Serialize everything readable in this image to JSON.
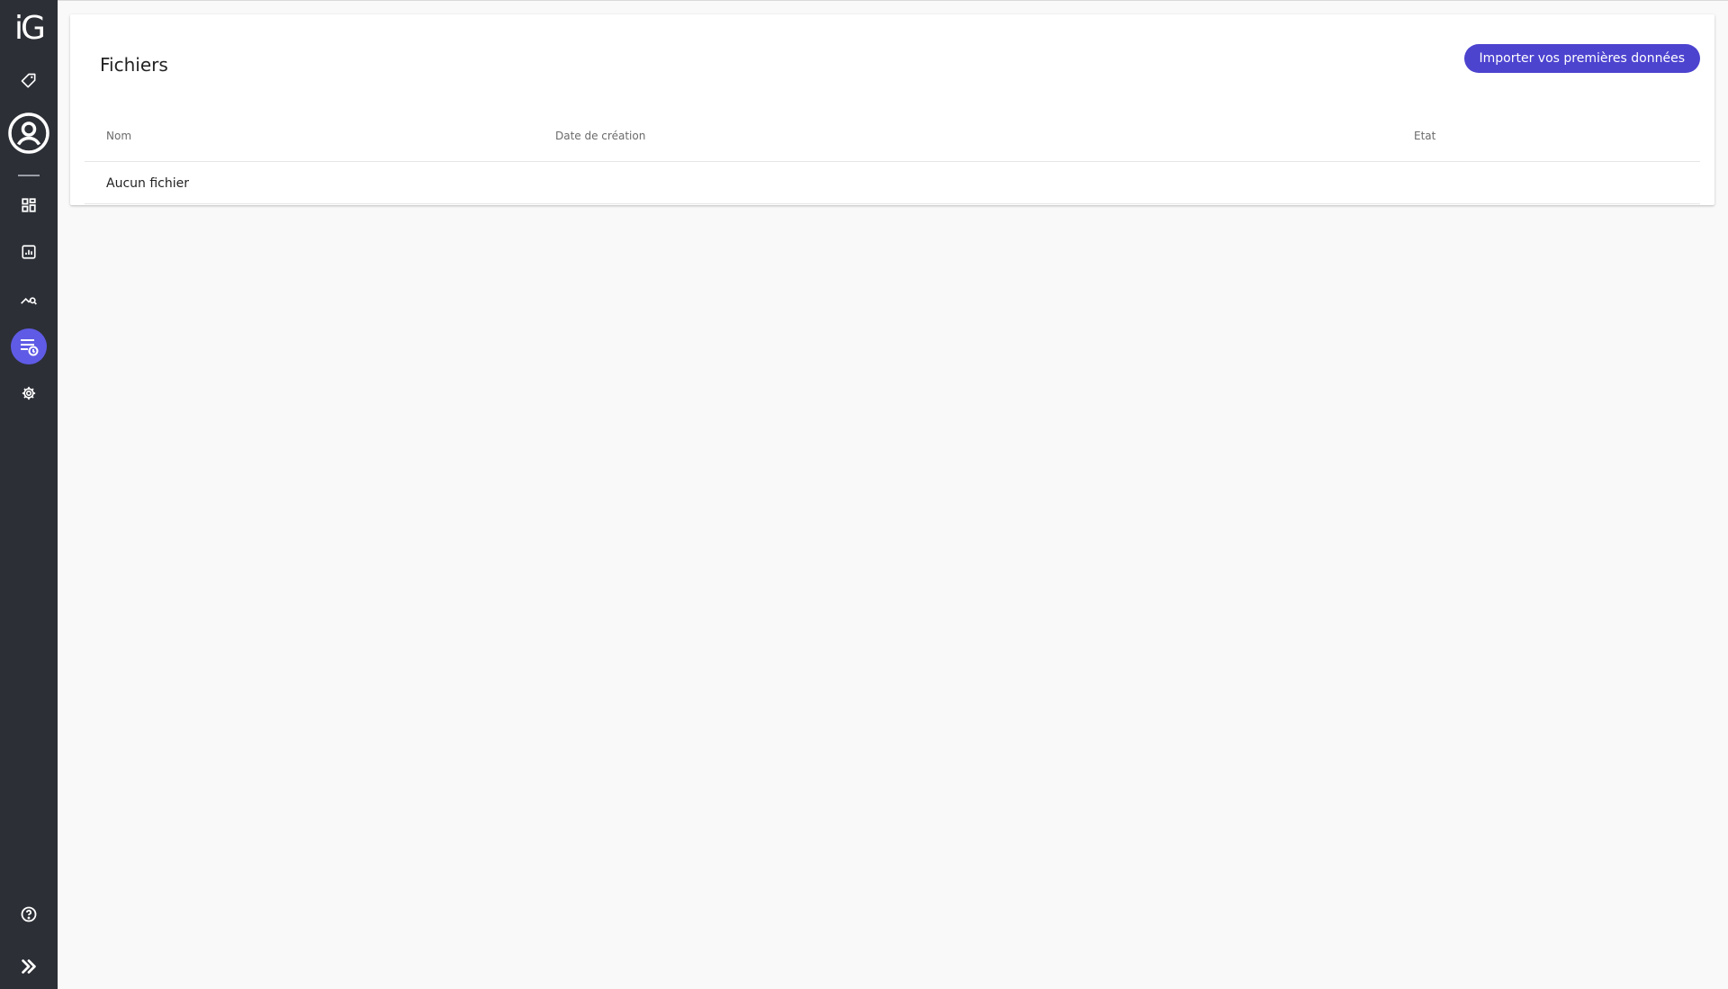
{
  "app": {
    "logo_text": "iG"
  },
  "sidebar": {
    "items": [
      {
        "name": "tag-icon"
      },
      {
        "name": "user-circle-icon"
      },
      {
        "name": "dashboard-grid-icon"
      },
      {
        "name": "report-chart-icon"
      },
      {
        "name": "analytics-search-icon"
      },
      {
        "name": "data-files-icon",
        "active": true
      },
      {
        "name": "gear-icon"
      },
      {
        "name": "help-icon"
      },
      {
        "name": "expand-icon"
      }
    ],
    "background_color": "#2c2f36",
    "active_color": "#5f5be6"
  },
  "main": {
    "title": "Fichiers",
    "import_button_label": "Importer vos premières données",
    "accent_color": "#4c43cf",
    "table": {
      "columns": [
        "Nom",
        "Date de création",
        "Etat"
      ],
      "empty_message": "Aucun fichier"
    }
  }
}
